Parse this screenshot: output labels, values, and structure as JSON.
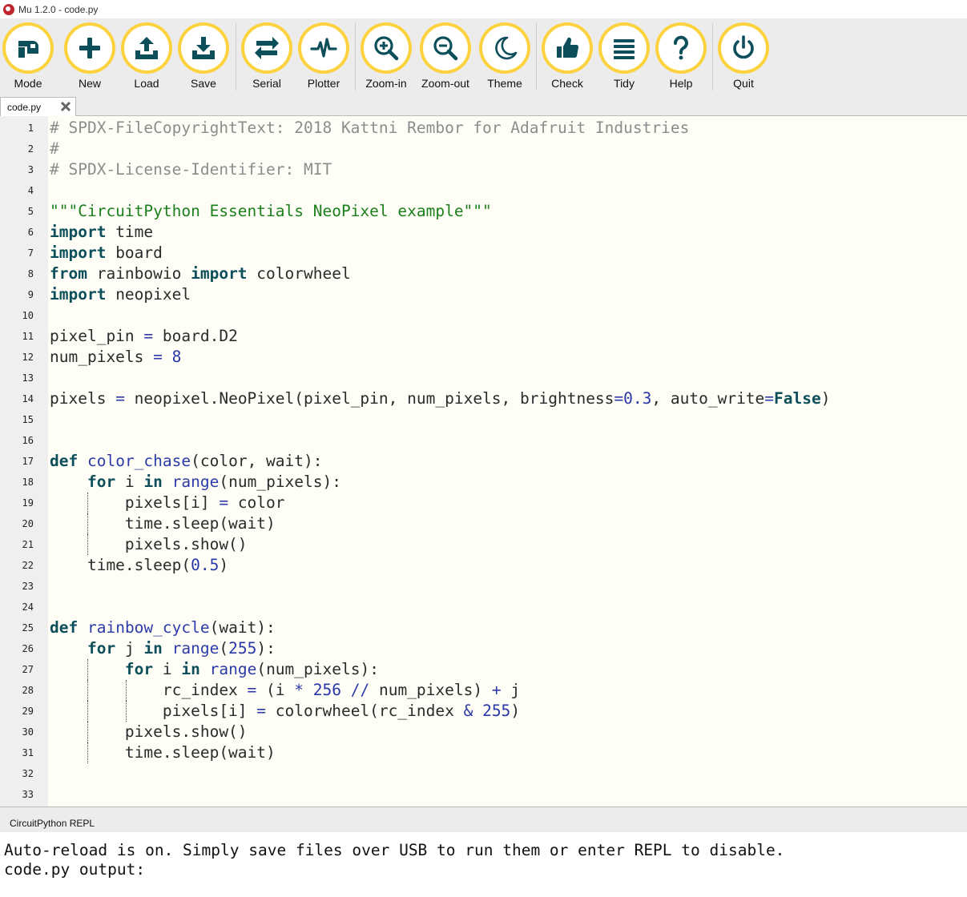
{
  "window": {
    "title": "Mu 1.2.0 - code.py"
  },
  "toolbar": {
    "buttons": [
      {
        "id": "mode",
        "label": "Mode",
        "icon": "mode-icon"
      },
      {
        "id": "new",
        "label": "New",
        "icon": "plus-icon"
      },
      {
        "id": "load",
        "label": "Load",
        "icon": "upload-icon"
      },
      {
        "id": "save",
        "label": "Save",
        "icon": "download-icon"
      },
      {
        "id": "serial",
        "label": "Serial",
        "icon": "swap-arrows-icon"
      },
      {
        "id": "plotter",
        "label": "Plotter",
        "icon": "pulse-icon"
      },
      {
        "id": "zoom-in",
        "label": "Zoom-in",
        "icon": "zoom-in-icon"
      },
      {
        "id": "zoom-out",
        "label": "Zoom-out",
        "icon": "zoom-out-icon"
      },
      {
        "id": "theme",
        "label": "Theme",
        "icon": "moon-icon"
      },
      {
        "id": "check",
        "label": "Check",
        "icon": "thumbs-up-icon"
      },
      {
        "id": "tidy",
        "label": "Tidy",
        "icon": "lines-icon"
      },
      {
        "id": "help",
        "label": "Help",
        "icon": "question-icon"
      },
      {
        "id": "quit",
        "label": "Quit",
        "icon": "power-icon"
      }
    ],
    "accent_color": "#fcd23e"
  },
  "tabs": [
    {
      "label": "code.py",
      "close_icon": "close-icon"
    }
  ],
  "editor": {
    "lines": [
      "# SPDX-FileCopyrightText: 2018 Kattni Rembor for Adafruit Industries",
      "#",
      "# SPDX-License-Identifier: MIT",
      "",
      "\"\"\"CircuitPython Essentials NeoPixel example\"\"\"",
      "import time",
      "import board",
      "from rainbowio import colorwheel",
      "import neopixel",
      "",
      "pixel_pin = board.D2",
      "num_pixels = 8",
      "",
      "pixels = neopixel.NeoPixel(pixel_pin, num_pixels, brightness=0.3, auto_write=False)",
      "",
      "",
      "def color_chase(color, wait):",
      "    for i in range(num_pixels):",
      "        pixels[i] = color",
      "        time.sleep(wait)",
      "        pixels.show()",
      "    time.sleep(0.5)",
      "",
      "",
      "def rainbow_cycle(wait):",
      "    for j in range(255):",
      "        for i in range(num_pixels):",
      "            rc_index = (i * 256 // num_pixels) + j",
      "            pixels[i] = colorwheel(rc_index & 255)",
      "        pixels.show()",
      "        time.sleep(wait)",
      "",
      ""
    ]
  },
  "repl": {
    "title": "CircuitPython REPL",
    "lines": [
      "Auto-reload is on. Simply save files over USB to run them or enter REPL to disable.",
      "code.py output:"
    ]
  }
}
